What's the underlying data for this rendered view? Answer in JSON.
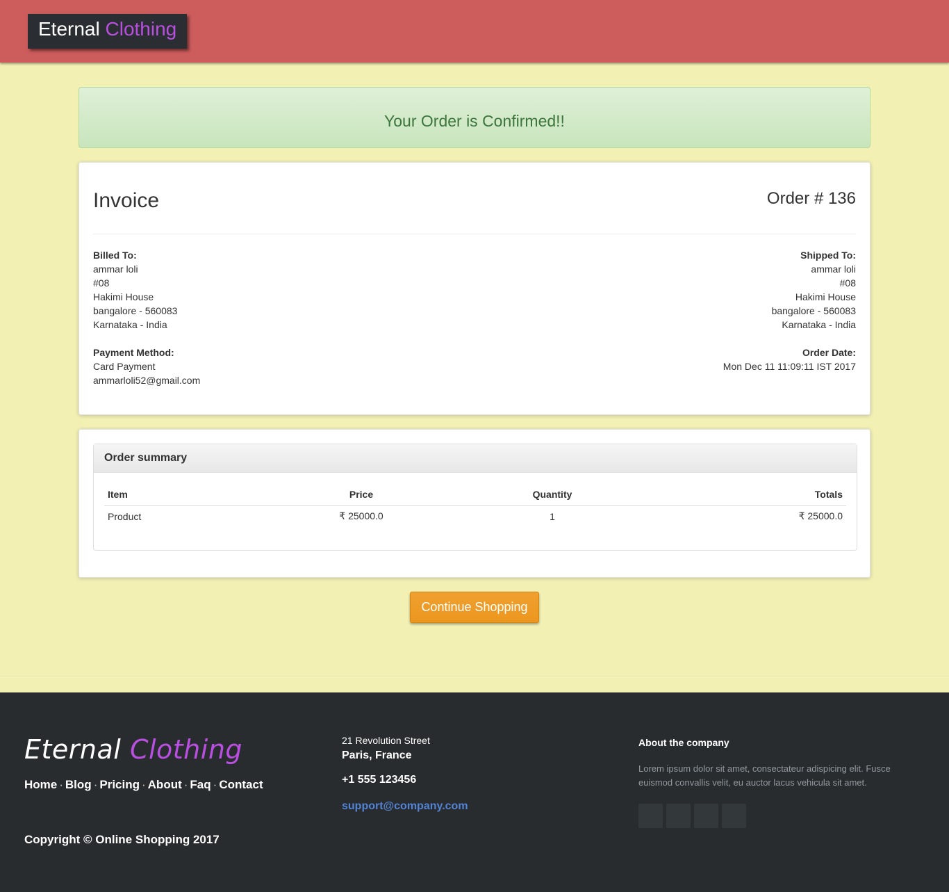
{
  "header": {
    "brand_main": "Eternal",
    "brand_accent": "Clothing"
  },
  "alert": {
    "message": "Your Order is Confirmed!!"
  },
  "invoice": {
    "title": "Invoice",
    "order_number": "Order # 136",
    "billed_to": {
      "label": "Billed To:",
      "name": "ammar loli",
      "line1": "#08",
      "line2": "Hakimi House",
      "line3": "bangalore - 560083",
      "line4": "Karnataka - India"
    },
    "shipped_to": {
      "label": "Shipped To:",
      "name": "ammar loli",
      "line1": "#08",
      "line2": "Hakimi House",
      "line3": "bangalore - 560083",
      "line4": "Karnataka - India"
    },
    "payment": {
      "label": "Payment Method:",
      "method": "Card Payment",
      "email": "ammarloli52@gmail.com"
    },
    "order_date": {
      "label": "Order Date:",
      "value": "Mon Dec 11 11:09:11 IST 2017"
    }
  },
  "summary": {
    "heading": "Order summary",
    "columns": [
      "Item",
      "Price",
      "Quantity",
      "Totals"
    ],
    "rows": [
      {
        "item": "Product",
        "price": "₹ 25000.0",
        "quantity": "1",
        "total": "₹ 25000.0"
      }
    ]
  },
  "continue_button": {
    "label": "Continue Shopping",
    "color": "#ec971f"
  },
  "footer": {
    "brand_main": "Eternal",
    "brand_accent": "Clothing",
    "links": [
      "Home",
      "Blog",
      "Pricing",
      "About",
      "Faq",
      "Contact"
    ],
    "separator": "·",
    "copyright": "Copyright © Online Shopping 2017",
    "street": "21 Revolution Street",
    "city": "Paris, France",
    "phone": "+1 555 123456",
    "email": "support@company.com",
    "about_title": "About the company",
    "about_text": "Lorem ipsum dolor sit amet, consectateur adispicing elit. Fusce euismod convallis velit, eu auctor lacus vehicula sit amet.",
    "social_icons": [
      "facebook-icon",
      "twitter-icon",
      "linkedin-icon",
      "github-icon"
    ]
  },
  "colors": {
    "header_bg": "#cd5c5c",
    "page_bg": "#f2f0b3",
    "brand_accent": "#b94fe0",
    "footer_bg": "#292c2f",
    "alert_text": "#3c763d",
    "link_blue": "#5383d3"
  }
}
